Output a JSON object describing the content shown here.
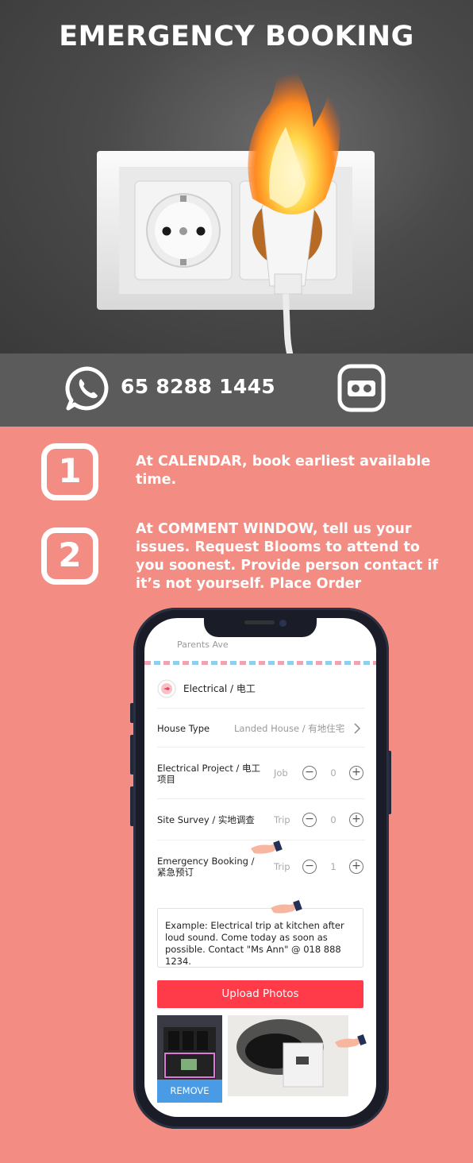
{
  "title": "EMERGENCY BOOKING",
  "contact": {
    "phone": "65 8288 1445",
    "whatsapp_icon": "whatsapp-icon",
    "voicemail_icon": "voicemail-icon"
  },
  "steps": [
    {
      "number": "1",
      "text": "At CALENDAR, book earliest available time."
    },
    {
      "number": "2",
      "text": "At COMMENT WINDOW, tell us your issues. Request Blooms to attend to you soonest. Provide person contact if it’s not yourself.  Place Order"
    }
  ],
  "app": {
    "address_snippet": "Parents Ave",
    "category": "Electrical / 电工",
    "house_type": {
      "label": "House Type",
      "value": "Landed House / 有地住宅"
    },
    "items": [
      {
        "label": "Electrical Project / 电工项目",
        "unit": "Job",
        "qty": "0"
      },
      {
        "label": "Site Survey / 实地调查",
        "unit": "Trip",
        "qty": "0"
      },
      {
        "label": "Emergency Booking / 紧急预订",
        "unit": "Trip",
        "qty": "1"
      }
    ],
    "comment": "Example: Electrical trip at kitchen after loud sound. Come today as soon as possible. Contact \"Ms Ann\" @ 018 888 1234.",
    "upload_label": "Upload Photos",
    "remove_label": "REMOVE",
    "minus": "−",
    "plus": "+"
  },
  "colors": {
    "background": "#f38c82",
    "upload_button": "#ff3b4a",
    "remove_button": "#4a9be6"
  }
}
